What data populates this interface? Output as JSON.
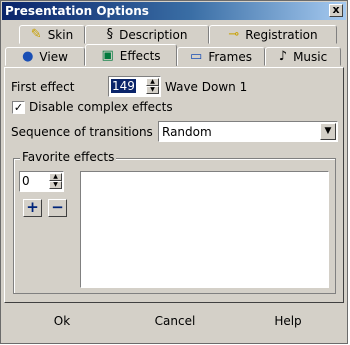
{
  "window": {
    "title": "Presentation Options",
    "close_label": "x"
  },
  "tabs": {
    "row1": [
      {
        "label": "Skin",
        "icon": "brush-icon"
      },
      {
        "label": "Description",
        "icon": "script-icon"
      },
      {
        "label": "Registration",
        "icon": "key-icon"
      }
    ],
    "row2": [
      {
        "label": "View",
        "icon": "globe-icon"
      },
      {
        "label": "Effects",
        "icon": "effects-icon"
      },
      {
        "label": "Frames",
        "icon": "frame-icon"
      },
      {
        "label": "Music",
        "icon": "music-note-icon"
      }
    ],
    "active": "Effects"
  },
  "effects": {
    "first_effect_label": "First effect",
    "first_effect_value": "149",
    "first_effect_name": "Wave Down 1",
    "disable_complex_label": "Disable complex effects",
    "disable_complex_checked": true,
    "sequence_label": "Sequence of transitions",
    "sequence_value": "Random",
    "favorites_label": "Favorite effects",
    "favorites_count": "0",
    "add_label": "+",
    "remove_label": "−"
  },
  "footer": {
    "ok": "Ok",
    "cancel": "Cancel",
    "help": "Help"
  },
  "colors": {
    "title_start": "#0a246a",
    "title_end": "#a6caf0",
    "face": "#d4d0c8",
    "accent_blue": "#00247a"
  }
}
